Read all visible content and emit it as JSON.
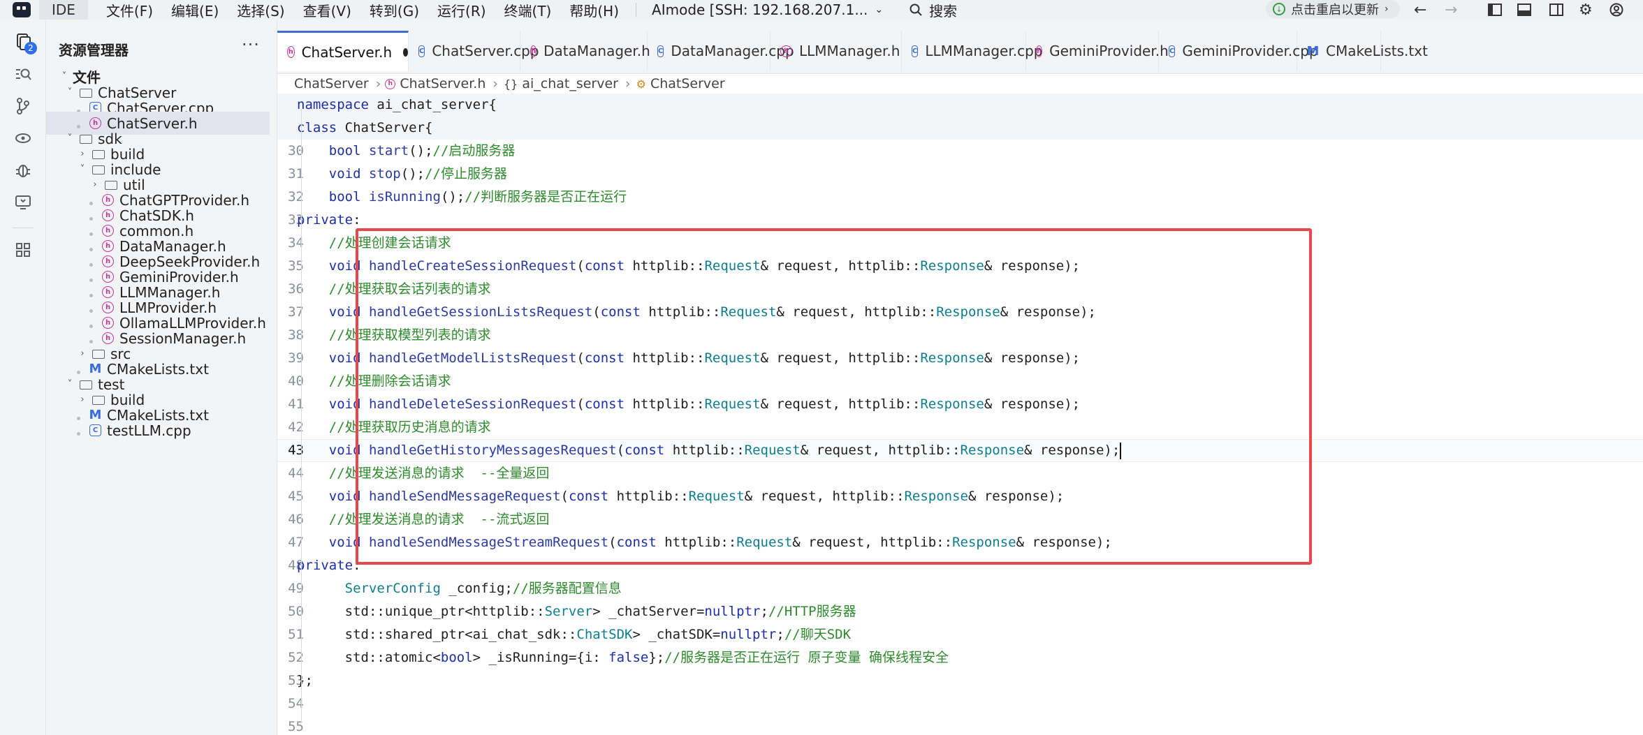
{
  "titlebar": {
    "ide_label": "IDE",
    "menus": [
      "文件(F)",
      "编辑(E)",
      "选择(S)",
      "查看(V)",
      "转到(G)",
      "运行(R)",
      "终端(T)",
      "帮助(H)"
    ],
    "ssh_label": "AImode [SSH: 192.168.207.1...",
    "search_label": "搜索",
    "update_label": "点击重启以更新"
  },
  "activity": {
    "explorer_badge": "2"
  },
  "sidebar": {
    "title": "资源管理器",
    "more": "···",
    "tree": [
      {
        "label": "文件",
        "kind": "root"
      },
      {
        "label": "ChatServer",
        "kind": "folder"
      },
      {
        "label": "ChatServer.cpp",
        "kind": "cpp"
      },
      {
        "label": "ChatServer.h",
        "kind": "h"
      },
      {
        "label": "sdk",
        "kind": "folder"
      },
      {
        "label": "build",
        "kind": "folder"
      },
      {
        "label": "include",
        "kind": "folder"
      },
      {
        "label": "util",
        "kind": "folder"
      },
      {
        "label": "ChatGPTProvider.h",
        "kind": "h"
      },
      {
        "label": "ChatSDK.h",
        "kind": "h"
      },
      {
        "label": "common.h",
        "kind": "h"
      },
      {
        "label": "DataManager.h",
        "kind": "h"
      },
      {
        "label": "DeepSeekProvider.h",
        "kind": "h"
      },
      {
        "label": "GeminiProvider.h",
        "kind": "h"
      },
      {
        "label": "LLMManager.h",
        "kind": "h"
      },
      {
        "label": "LLMProvider.h",
        "kind": "h"
      },
      {
        "label": "OllamaLLMProvider.h",
        "kind": "h"
      },
      {
        "label": "SessionManager.h",
        "kind": "h"
      },
      {
        "label": "src",
        "kind": "folder"
      },
      {
        "label": "CMakeLists.txt",
        "kind": "cmake"
      },
      {
        "label": "test",
        "kind": "folder"
      },
      {
        "label": "build",
        "kind": "folder"
      },
      {
        "label": "CMakeLists.txt",
        "kind": "cmake"
      },
      {
        "label": "testLLM.cpp",
        "kind": "cpp"
      }
    ]
  },
  "tabs": [
    {
      "label": "ChatServer.h",
      "kind": "h"
    },
    {
      "label": "ChatServer.cpp",
      "kind": "cpp"
    },
    {
      "label": "DataManager.h",
      "kind": "h"
    },
    {
      "label": "DataManager.cpp",
      "kind": "cpp"
    },
    {
      "label": "LLMManager.h",
      "kind": "h"
    },
    {
      "label": "LLMManager.cpp",
      "kind": "cpp"
    },
    {
      "label": "GeminiProvider.h",
      "kind": "h"
    },
    {
      "label": "GeminiProvider.cpp",
      "kind": "cpp"
    },
    {
      "label": "CMakeLists.txt",
      "kind": "cmake"
    }
  ],
  "breadcrumb": [
    "ChatServer",
    "ChatServer.h",
    "ai_chat_server",
    "ChatServer"
  ],
  "editor": {
    "sticky": [
      "namespace ai_chat_server{",
      "class ChatServer{"
    ],
    "line_numbers": [
      "30",
      "31",
      "32",
      "33",
      "34",
      "35",
      "36",
      "37",
      "38",
      "39",
      "40",
      "41",
      "42",
      "43",
      "44",
      "45",
      "46",
      "47",
      "48",
      "49",
      "50",
      "51",
      "52",
      "53",
      "54",
      "55"
    ],
    "lines": [
      "    bool start();//启动服务器",
      "    void stop();//停止服务器",
      "    bool isRunning();//判断服务器是否正在运行",
      "private:",
      "    //处理创建会话请求",
      "    void handleCreateSessionRequest(const httplib::Request& request, httplib::Response& response);",
      "    //处理获取会话列表的请求",
      "    void handleGetSessionListsRequest(const httplib::Request& request, httplib::Response& response);",
      "    //处理获取模型列表的请求",
      "    void handleGetModelListsRequest(const httplib::Request& request, httplib::Response& response);",
      "    //处理删除会话请求",
      "    void handleDeleteSessionRequest(const httplib::Request& request, httplib::Response& response);",
      "    //处理获取历史消息的请求",
      "    void handleGetHistoryMessagesRequest(const httplib::Request& request, httplib::Response& response);",
      "    //处理发送消息的请求  --全量返回",
      "    void handleSendMessageRequest(const httplib::Request& request, httplib::Response& response);",
      "    //处理发送消息的请求  --流式返回",
      "    void handleSendMessageStreamRequest(const httplib::Request& request, httplib::Response& response);",
      "private:",
      "      ServerConfig _config;//服务器配置信息",
      "      std::unique_ptr<httplib::Server> _chatServer=nullptr;//HTTP服务器",
      "      std::shared_ptr<ai_chat_sdk::ChatSDK> _chatSDK=nullptr;//聊天SDK",
      "      std::atomic<bool> _isRunning={i: false};//服务器是否正在运行 原子变量 确保线程安全",
      "};",
      "",
      ""
    ],
    "current_line": "43"
  },
  "colors": {
    "accent": "#3c6fd1",
    "highlight_box": "#e5484d",
    "comment": "#2f8a2e",
    "keyword": "#1c2ea8"
  }
}
